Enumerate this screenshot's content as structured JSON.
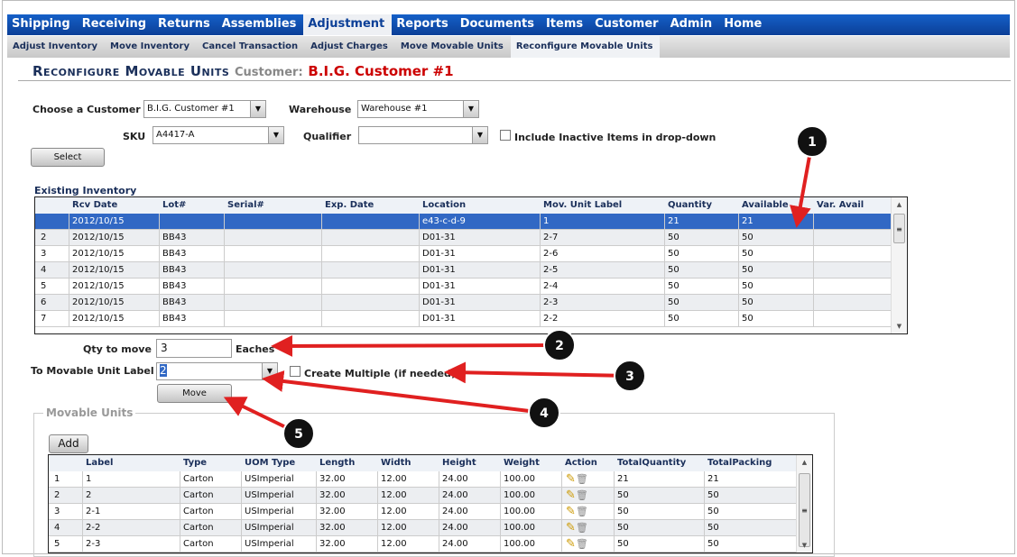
{
  "nav": {
    "items": [
      "Shipping",
      "Receiving",
      "Returns",
      "Assemblies",
      "Adjustment",
      "Reports",
      "Documents",
      "Items",
      "Customer",
      "Admin",
      "Home"
    ],
    "active": 4
  },
  "subnav": {
    "items": [
      "Adjust Inventory",
      "Move Inventory",
      "Cancel Transaction",
      "Adjust Charges",
      "Move Movable Units",
      "Reconfigure Movable Units"
    ],
    "active": 5
  },
  "page": {
    "title": "Reconfigure Movable Units",
    "customer_label": "Customer:",
    "customer_name": "B.I.G. Customer #1"
  },
  "form": {
    "customer_label": "Choose a Customer",
    "customer_value": "B.I.G. Customer #1",
    "warehouse_label": "Warehouse",
    "warehouse_value": "Warehouse #1",
    "sku_label": "SKU",
    "sku_value": "A4417-A",
    "qualifier_label": "Qualifier",
    "qualifier_value": "",
    "inactive_label": "Include Inactive Items in drop-down",
    "inactive_checked": false,
    "select_button": "Select"
  },
  "inventory": {
    "title": "Existing Inventory",
    "columns": [
      "",
      "Rcv Date",
      "Lot#",
      "Serial#",
      "Exp. Date",
      "Location",
      "Mov. Unit Label",
      "Quantity",
      "Available",
      "Var. Avail"
    ],
    "rows": [
      [
        "",
        "2012/10/15",
        "",
        "",
        "",
        "e43-c-d-9",
        "1",
        "21",
        "21",
        ""
      ],
      [
        "2",
        "2012/10/15",
        "BB43",
        "",
        "",
        "D01-31",
        "2-7",
        "50",
        "50",
        ""
      ],
      [
        "3",
        "2012/10/15",
        "BB43",
        "",
        "",
        "D01-31",
        "2-6",
        "50",
        "50",
        ""
      ],
      [
        "4",
        "2012/10/15",
        "BB43",
        "",
        "",
        "D01-31",
        "2-5",
        "50",
        "50",
        ""
      ],
      [
        "5",
        "2012/10/15",
        "BB43",
        "",
        "",
        "D01-31",
        "2-4",
        "50",
        "50",
        ""
      ],
      [
        "6",
        "2012/10/15",
        "BB43",
        "",
        "",
        "D01-31",
        "2-3",
        "50",
        "50",
        ""
      ],
      [
        "7",
        "2012/10/15",
        "BB43",
        "",
        "",
        "D01-31",
        "2-2",
        "50",
        "50",
        ""
      ]
    ],
    "selected_row": 0
  },
  "move": {
    "qty_label": "Qty to move",
    "qty_value": "3",
    "unit": "Eaches",
    "to_label": "To Movable Unit Label",
    "to_value": "2",
    "multiple_label": "Create Multiple (if needed)",
    "multiple_checked": false,
    "move_button": "Move"
  },
  "movable": {
    "title": "Movable Units",
    "add_button": "Add",
    "columns": [
      "",
      "Label",
      "Type",
      "UOM Type",
      "Length",
      "Width",
      "Height",
      "Weight",
      "Action",
      "TotalQuantity",
      "TotalPacking"
    ],
    "rows": [
      [
        "1",
        "1",
        "Carton",
        "USImperial",
        "32.00",
        "12.00",
        "24.00",
        "100.00",
        "",
        "21",
        "21"
      ],
      [
        "2",
        "2",
        "Carton",
        "USImperial",
        "32.00",
        "12.00",
        "24.00",
        "100.00",
        "",
        "50",
        "50"
      ],
      [
        "3",
        "2-1",
        "Carton",
        "USImperial",
        "32.00",
        "12.00",
        "24.00",
        "100.00",
        "",
        "50",
        "50"
      ],
      [
        "4",
        "2-2",
        "Carton",
        "USImperial",
        "32.00",
        "12.00",
        "24.00",
        "100.00",
        "",
        "50",
        "50"
      ],
      [
        "5",
        "2-3",
        "Carton",
        "USImperial",
        "32.00",
        "12.00",
        "24.00",
        "100.00",
        "",
        "50",
        "50"
      ]
    ]
  },
  "annotations": [
    "1",
    "2",
    "3",
    "4",
    "5"
  ],
  "colors": {
    "nav": "#0b3f97",
    "selected_row": "#3168c4",
    "arrow": "#e02020",
    "title_red": "#cc0000"
  }
}
